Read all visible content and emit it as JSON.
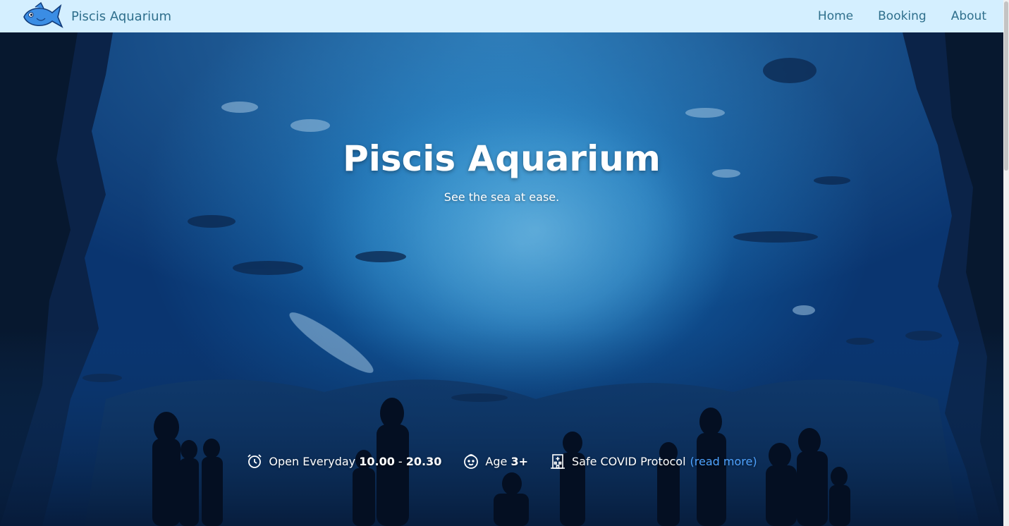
{
  "brand": {
    "name": "Piscis Aquarium",
    "logo_icon": "fish-logo-icon"
  },
  "nav": {
    "items": [
      {
        "label": "Home"
      },
      {
        "label": "Booking"
      },
      {
        "label": "About"
      }
    ]
  },
  "hero": {
    "title": "Piscis Aquarium",
    "subtitle": "See the sea at ease.",
    "info": {
      "hours_prefix": "Open Everyday",
      "hours_open": "10.00",
      "hours_sep": " - ",
      "hours_close": "20.30",
      "age_prefix": "Age",
      "age_value": "3+",
      "covid_text": "Safe COVID Protocol",
      "read_more": "(read more)"
    }
  },
  "colors": {
    "navbar_bg": "#d4efff",
    "nav_text": "#2f6f8c",
    "link": "#4fa3ff",
    "hero_text": "#ffffff"
  }
}
